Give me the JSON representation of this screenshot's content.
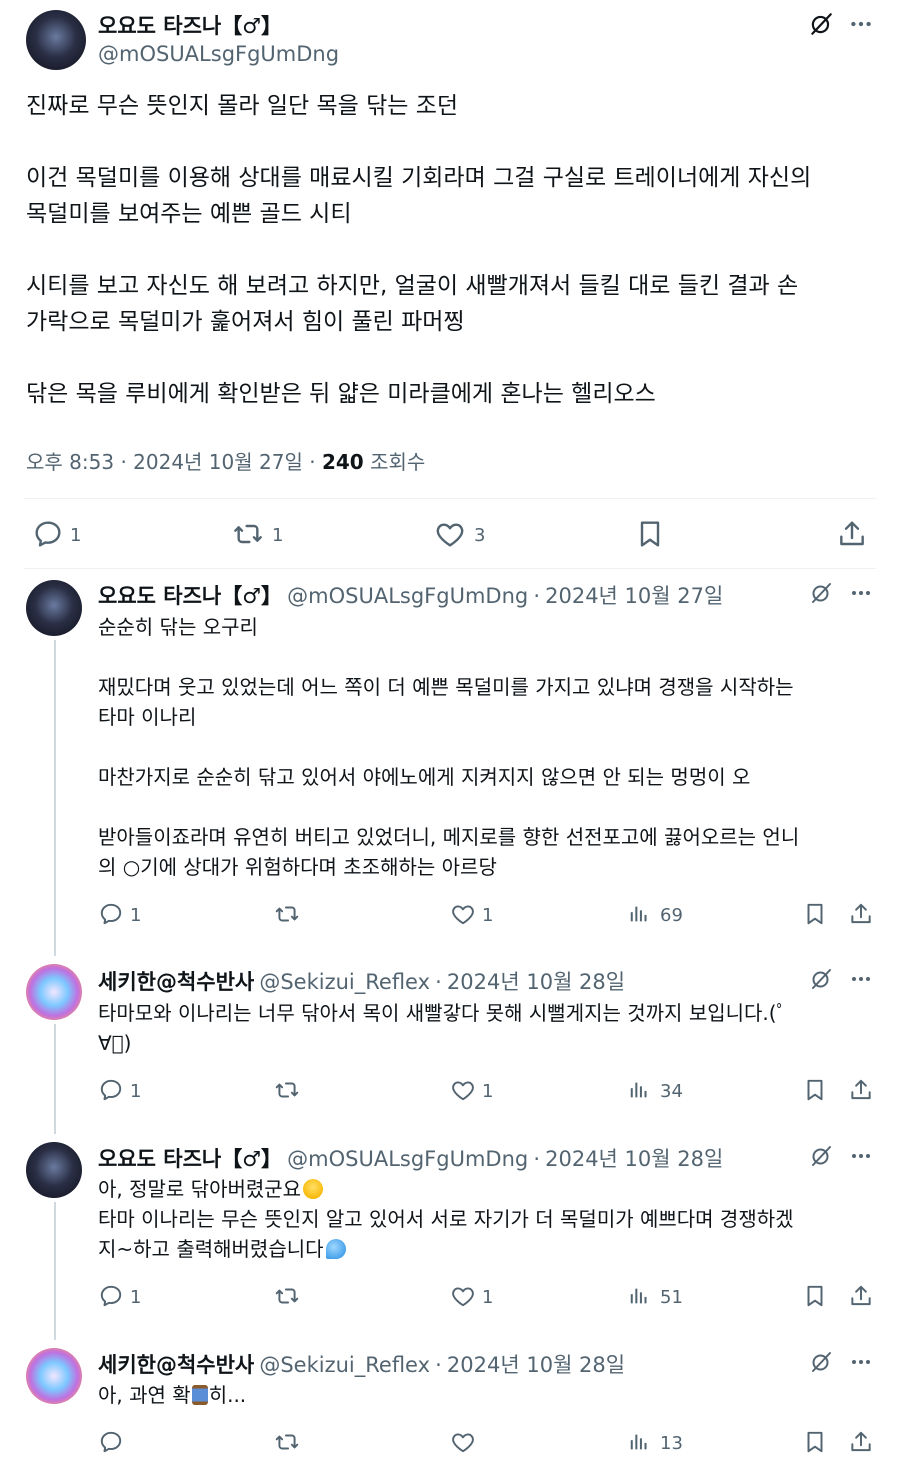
{
  "main_tweet": {
    "display_name": "오요도 타즈나【♂】",
    "handle": "@mOSUALsgFgUmDng",
    "paragraphs": [
      [
        "진짜로 무슨 뜻인지 몰라 일단 목을 닦는 조던"
      ],
      [
        "이건 목덜미를 이용해 상대를 매료시킬 기회라며 그걸 구실로 트레이너에게 자신의",
        "목덜미를 보여주는 예쁜 골드 시티"
      ],
      [
        "시티를 보고 자신도 해 보려고 하지만, 얼굴이 새빨개져서 들킬 대로 들킨 결과 손",
        "가락으로 목덜미가 훑어져서 힘이 풀린 파머찡"
      ],
      [
        "닦은 목을 루비에게 확인받은 뒤 얇은 미라클에게 혼나는 헬리오스"
      ]
    ],
    "time": "오후 8:53",
    "date": "2024년 10월 27일",
    "views": "240",
    "views_label": "조회수",
    "replies": "1",
    "retweets": "1",
    "likes": "3"
  },
  "replies": [
    {
      "display_name": "오요도 타즈나【♂】",
      "handle": "@mOSUALsgFgUmDng",
      "date": "2024년 10월 27일",
      "lines": [
        "순순히 닦는 오구리",
        "",
        "재밌다며 웃고 있었는데 어느 쪽이 더 예쁜 목덜미를 가지고 있냐며 경쟁을 시작하는",
        "타마 이나리",
        "",
        "마찬가지로 순순히 닦고 있어서 야에노에게 지켜지지 않으면 안 되는 멍멍이 오",
        "",
        "받아들이죠라며 유연히 버티고 있었더니, 메지로를 향한 선전포고에 끓어오르는 언니",
        "의 ○기에 상대가 위험하다며 초조해하는 아르당"
      ],
      "replies": "1",
      "retweets": "",
      "likes": "1",
      "views": "69"
    },
    {
      "display_name": "세키한@척수반사",
      "handle": "@Sekizui_Reflex",
      "date": "2024년 10월 28일",
      "lines": [
        "타마모와 이나리는 너무 닦아서 목이 새빨갛다 못해 시뻘게지는 것까지 보입니다.(ﾟ",
        "∀ﾟ)"
      ],
      "replies": "1",
      "retweets": "",
      "likes": "1",
      "views": "34"
    },
    {
      "display_name": "오요도 타즈나【♂】",
      "handle": "@mOSUALsgFgUmDng",
      "date": "2024년 10월 28일",
      "lines": [
        "아, 정말로 닦아버렸군요",
        "타마 이나리는 무슨 뜻인지 알고 있어서 서로 자기가 더 목덜미가 예쁘다며 경쟁하겠",
        "지~하고 출력해버렸습니다"
      ],
      "replies": "1",
      "retweets": "",
      "likes": "1",
      "views": "51"
    },
    {
      "display_name": "세키한@척수반사",
      "handle": "@Sekizui_Reflex",
      "date": "2024년 10월 28일",
      "lines_parts": [
        "아, 과연 확",
        "히..."
      ],
      "replies": "",
      "retweets": "",
      "likes": "",
      "views": "13"
    }
  ],
  "separator": "·",
  "icons": [
    "grok-icon",
    "more-icon",
    "reply-icon",
    "retweet-icon",
    "like-icon",
    "bookmark-icon",
    "share-icon",
    "views-icon"
  ],
  "colors": {
    "text": "#0f1419",
    "secondary": "#536471",
    "divider": "#eff3f4",
    "thread_line": "#cfd9de"
  }
}
